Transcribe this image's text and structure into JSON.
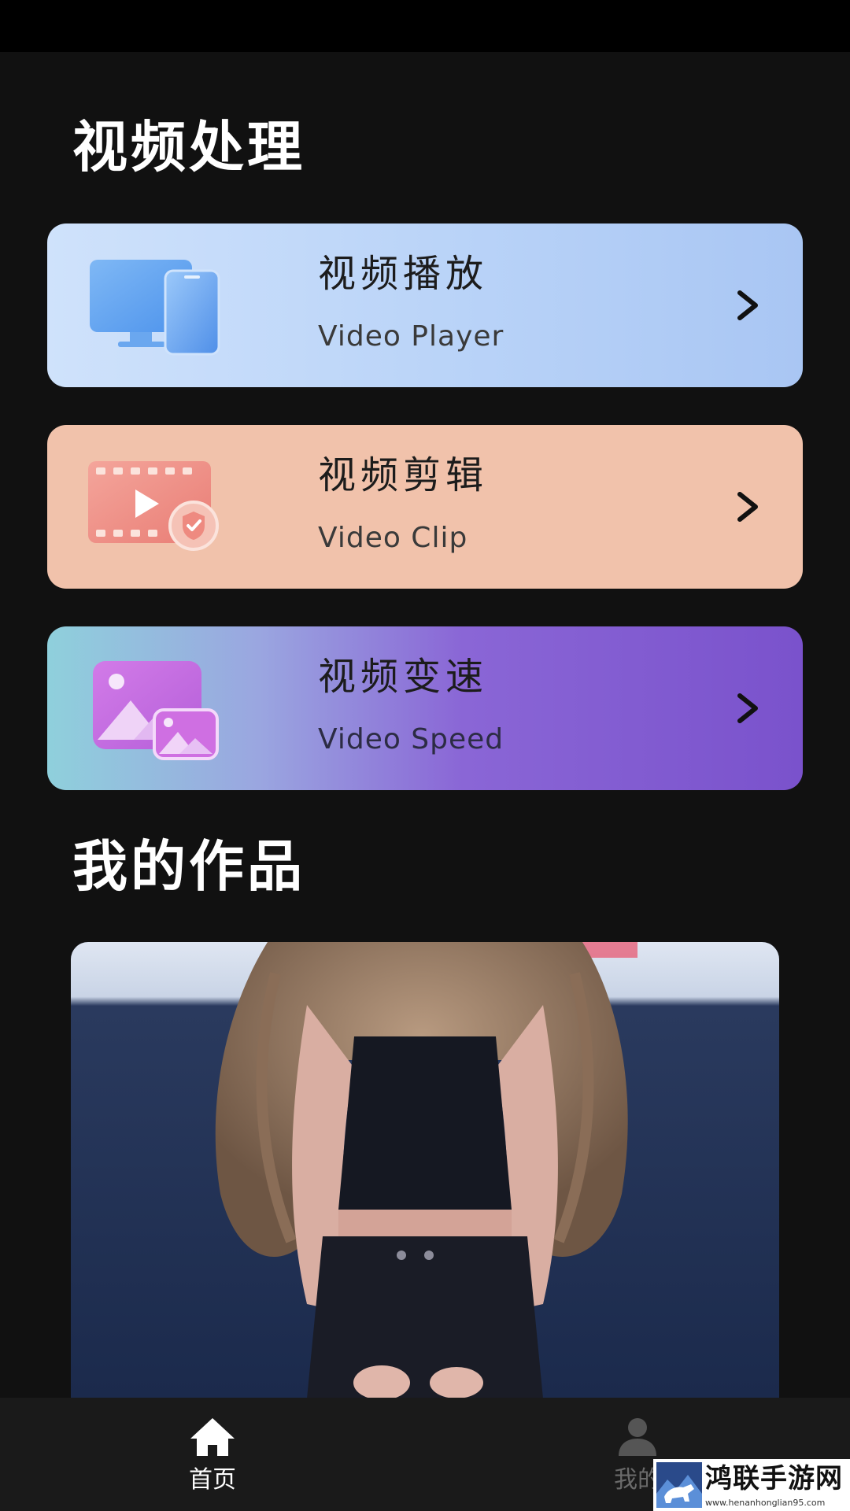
{
  "sections": {
    "video_processing_title": "视频处理",
    "my_works_title": "我的作品"
  },
  "cards": [
    {
      "title": "视频播放",
      "subtitle": "Video Player",
      "icon": "devices-icon"
    },
    {
      "title": "视频剪辑",
      "subtitle": "Video Clip",
      "icon": "film-strip-icon"
    },
    {
      "title": "视频变速",
      "subtitle": "Video Speed",
      "icon": "images-icon"
    }
  ],
  "works": [
    {
      "thumbnail": "dancer-video-thumbnail"
    }
  ],
  "bottom_nav": {
    "home_label": "首页",
    "mine_label": "我的",
    "active": "home"
  },
  "watermark": {
    "text": "鸿联手游网",
    "url": "www.henanhonglian95.com"
  },
  "colors": {
    "background": "#111111",
    "player_card": "#b9d3f8",
    "clip_card": "#f1c2ab",
    "speed_card": "#7a52cc",
    "nav_active": "#ffffff",
    "nav_inactive": "#6a6a6a"
  }
}
